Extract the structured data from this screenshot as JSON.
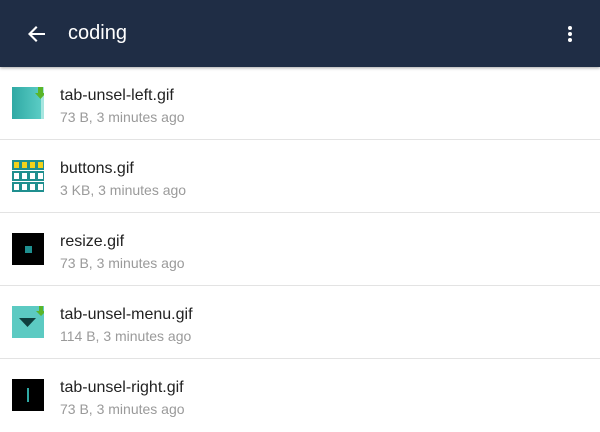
{
  "appbar": {
    "title": "coding",
    "back_icon": "arrow-left-icon",
    "menu_icon": "more-vert-icon",
    "background_color": "#1f2d45"
  },
  "files": [
    {
      "name": "tab-unsel-left.gif",
      "meta": "73 B, 3 minutes ago",
      "thumb": "teal-gradient-arrow"
    },
    {
      "name": "buttons.gif",
      "meta": "3 KB, 3 minutes ago",
      "thumb": "button-grid"
    },
    {
      "name": "resize.gif",
      "meta": "73 B, 3 minutes ago",
      "thumb": "black-square-dot"
    },
    {
      "name": "tab-unsel-menu.gif",
      "meta": "114 B, 3 minutes ago",
      "thumb": "teal-dropdown-arrow"
    },
    {
      "name": "tab-unsel-right.gif",
      "meta": "73 B, 3 minutes ago",
      "thumb": "black-vertical-line"
    }
  ]
}
